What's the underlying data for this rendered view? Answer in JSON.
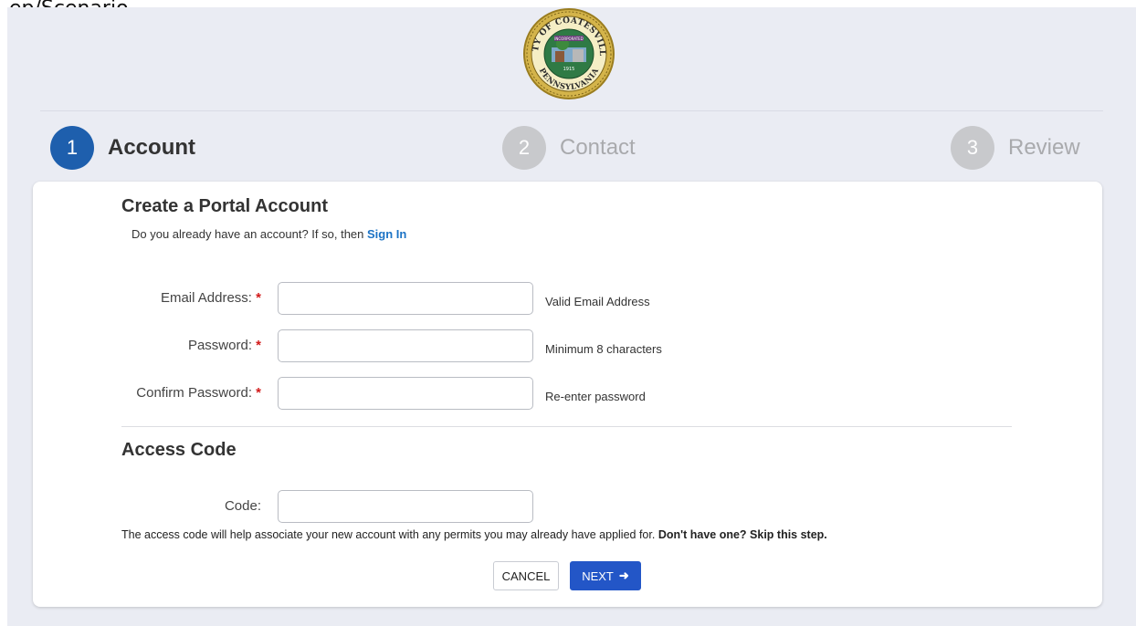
{
  "top_note": "ep/Scenario",
  "logo": {
    "top_text": "CITY OF COATESVILLE",
    "bottom_text": "PENNSYLVANIA",
    "ribbon_text": "INCORPORATED",
    "year": "1915",
    "ring_color": "#c9a93a",
    "inner_color": "#1e6a3a"
  },
  "steps": [
    {
      "number": "1",
      "label": "Account"
    },
    {
      "number": "2",
      "label": "Contact"
    },
    {
      "number": "3",
      "label": "Review"
    }
  ],
  "account_section": {
    "title": "Create a Portal Account",
    "prompt": "Do you already have an account? If so, then",
    "sign_in_link": "Sign In"
  },
  "fields": {
    "email": {
      "label": "Email Address:",
      "required": "*",
      "value": "",
      "hint": "Valid Email Address"
    },
    "password": {
      "label": "Password:",
      "required": "*",
      "value": "",
      "hint": "Minimum 8 characters"
    },
    "confirm_password": {
      "label": "Confirm Password:",
      "required": "*",
      "value": "",
      "hint": "Re-enter password"
    }
  },
  "access_code": {
    "title": "Access Code",
    "label": "Code:",
    "value": "",
    "note_text": "The access code will help associate your new account with any permits you may already have applied for.",
    "note_bold": "Don't have one? Skip this step."
  },
  "buttons": {
    "cancel": "CANCEL",
    "next": "NEXT",
    "next_icon": "arrow-right-icon"
  },
  "colors": {
    "active_step": "#1e5fad",
    "inactive_step": "#c8c9cc",
    "link": "#1c73c5",
    "required": "#d21a1a",
    "primary_button": "#2356c7",
    "app_background": "#eaecf3"
  }
}
